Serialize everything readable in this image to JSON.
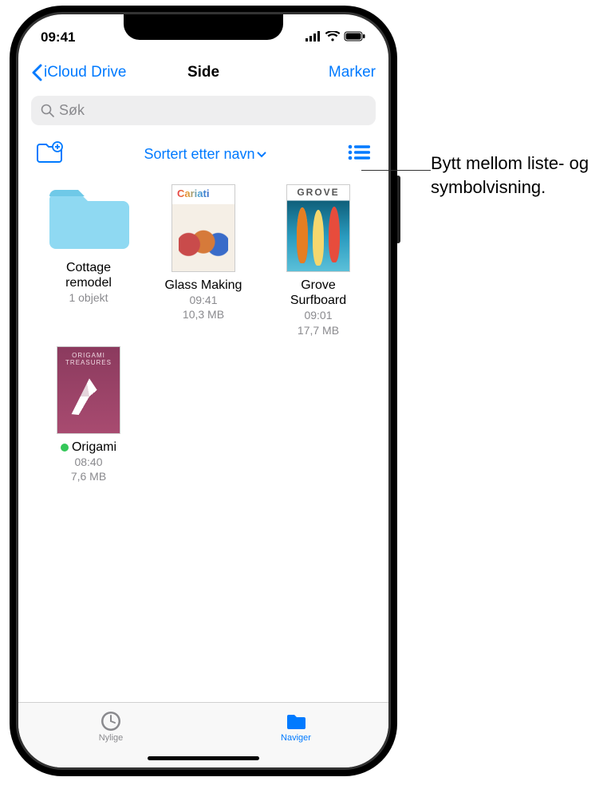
{
  "status": {
    "time": "09:41"
  },
  "nav": {
    "back_label": "iCloud Drive",
    "title": "Side",
    "action_label": "Marker"
  },
  "search": {
    "placeholder": "Søk"
  },
  "toolbar": {
    "sort_label": "Sortert etter navn"
  },
  "items": [
    {
      "name_line1": "Cottage",
      "name_line2": "remodel",
      "meta1": "1 objekt",
      "meta2": "",
      "kind": "folder",
      "dot": false
    },
    {
      "name_line1": "Glass Making",
      "name_line2": "",
      "meta1": "09:41",
      "meta2": "10,3 MB",
      "kind": "cariati",
      "dot": false
    },
    {
      "name_line1": "Grove",
      "name_line2": "Surfboard",
      "meta1": "09:01",
      "meta2": "17,7 MB",
      "kind": "grove",
      "dot": false
    },
    {
      "name_line1": "Origami",
      "name_line2": "",
      "meta1": "08:40",
      "meta2": "7,6 MB",
      "kind": "origami",
      "dot": true
    }
  ],
  "tabs": {
    "recent": "Nylige",
    "browse": "Naviger"
  },
  "callout": "Bytt mellom liste- og symbolvisning."
}
